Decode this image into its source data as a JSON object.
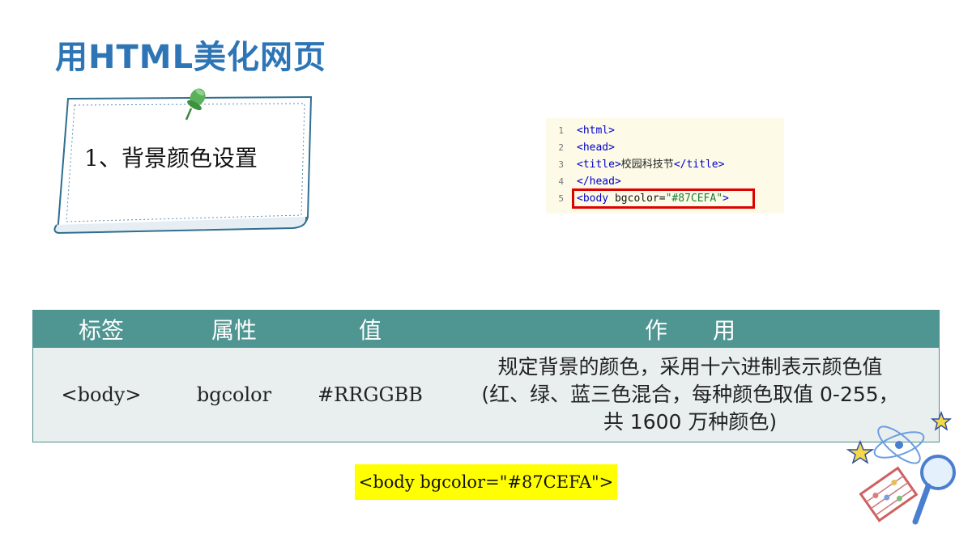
{
  "title": "用HTML美化网页",
  "note": {
    "text": "1、背景颜色设置"
  },
  "code_snippet": {
    "lines": [
      {
        "num": "1",
        "tag": "<html>"
      },
      {
        "num": "2",
        "tag": "<head>"
      },
      {
        "num": "3",
        "tag_open": "<title>",
        "text": "校园科技节",
        "tag_close": "</title>"
      },
      {
        "num": "4",
        "tag": "</head>"
      },
      {
        "num": "5",
        "tag_open": "<body ",
        "attr": "bgcolor=",
        "value": "\"#87CEFA\"",
        "tag_close": ">"
      }
    ]
  },
  "table": {
    "headers": [
      "标签",
      "属性",
      "值",
      "作　　用"
    ],
    "row": {
      "tag": "<body>",
      "attribute": "bgcolor",
      "value": "#RRGGBB",
      "purpose_lines": [
        "规定背景的颜色，采用十六进制表示颜色值",
        "(红、绿、蓝三色混合，每种颜色取值 0-255，",
        "共 1600 万种颜色)"
      ]
    }
  },
  "example": "<body bgcolor=\"#87CEFA\">",
  "colors": {
    "title": "#2e75b6",
    "table_header": "#4f9591",
    "table_body": "#e9efef",
    "highlight_border": "#e00000",
    "example_bg": "#ffff00"
  }
}
